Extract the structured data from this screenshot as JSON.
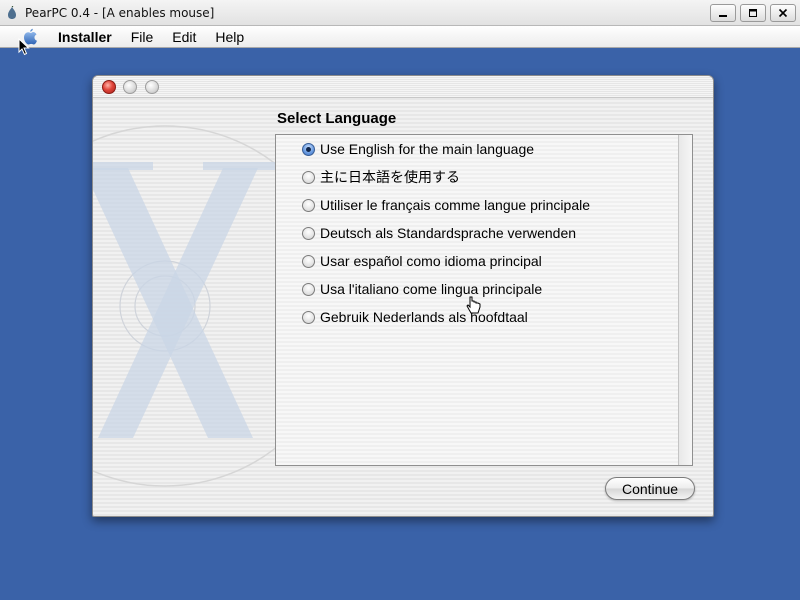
{
  "host_window": {
    "title": "PearPC 0.4 - [A enables mouse]",
    "buttons": [
      "minimize-icon",
      "restore-icon",
      "close-icon"
    ]
  },
  "menubar": {
    "apple_icon": "apple-logo-icon",
    "items": [
      "Installer",
      "File",
      "Edit",
      "Help"
    ]
  },
  "installer": {
    "panel_title": "Select Language",
    "languages": [
      {
        "label": "Use English for the main language",
        "selected": true
      },
      {
        "label": "主に日本語を使用する",
        "selected": false
      },
      {
        "label": "Utiliser le français comme langue principale",
        "selected": false
      },
      {
        "label": "Deutsch als Standardsprache verwenden",
        "selected": false
      },
      {
        "label": "Usar español como idioma principal",
        "selected": false
      },
      {
        "label": "Usa l'italiano come lingua principale",
        "selected": false
      },
      {
        "label": "Gebruik Nederlands als hoofdtaal",
        "selected": false
      }
    ],
    "continue_label": "Continue"
  },
  "colors": {
    "desktop": "#3a62a8",
    "close_button": "#e0443a",
    "radio_selected": "#3b6fc0"
  }
}
